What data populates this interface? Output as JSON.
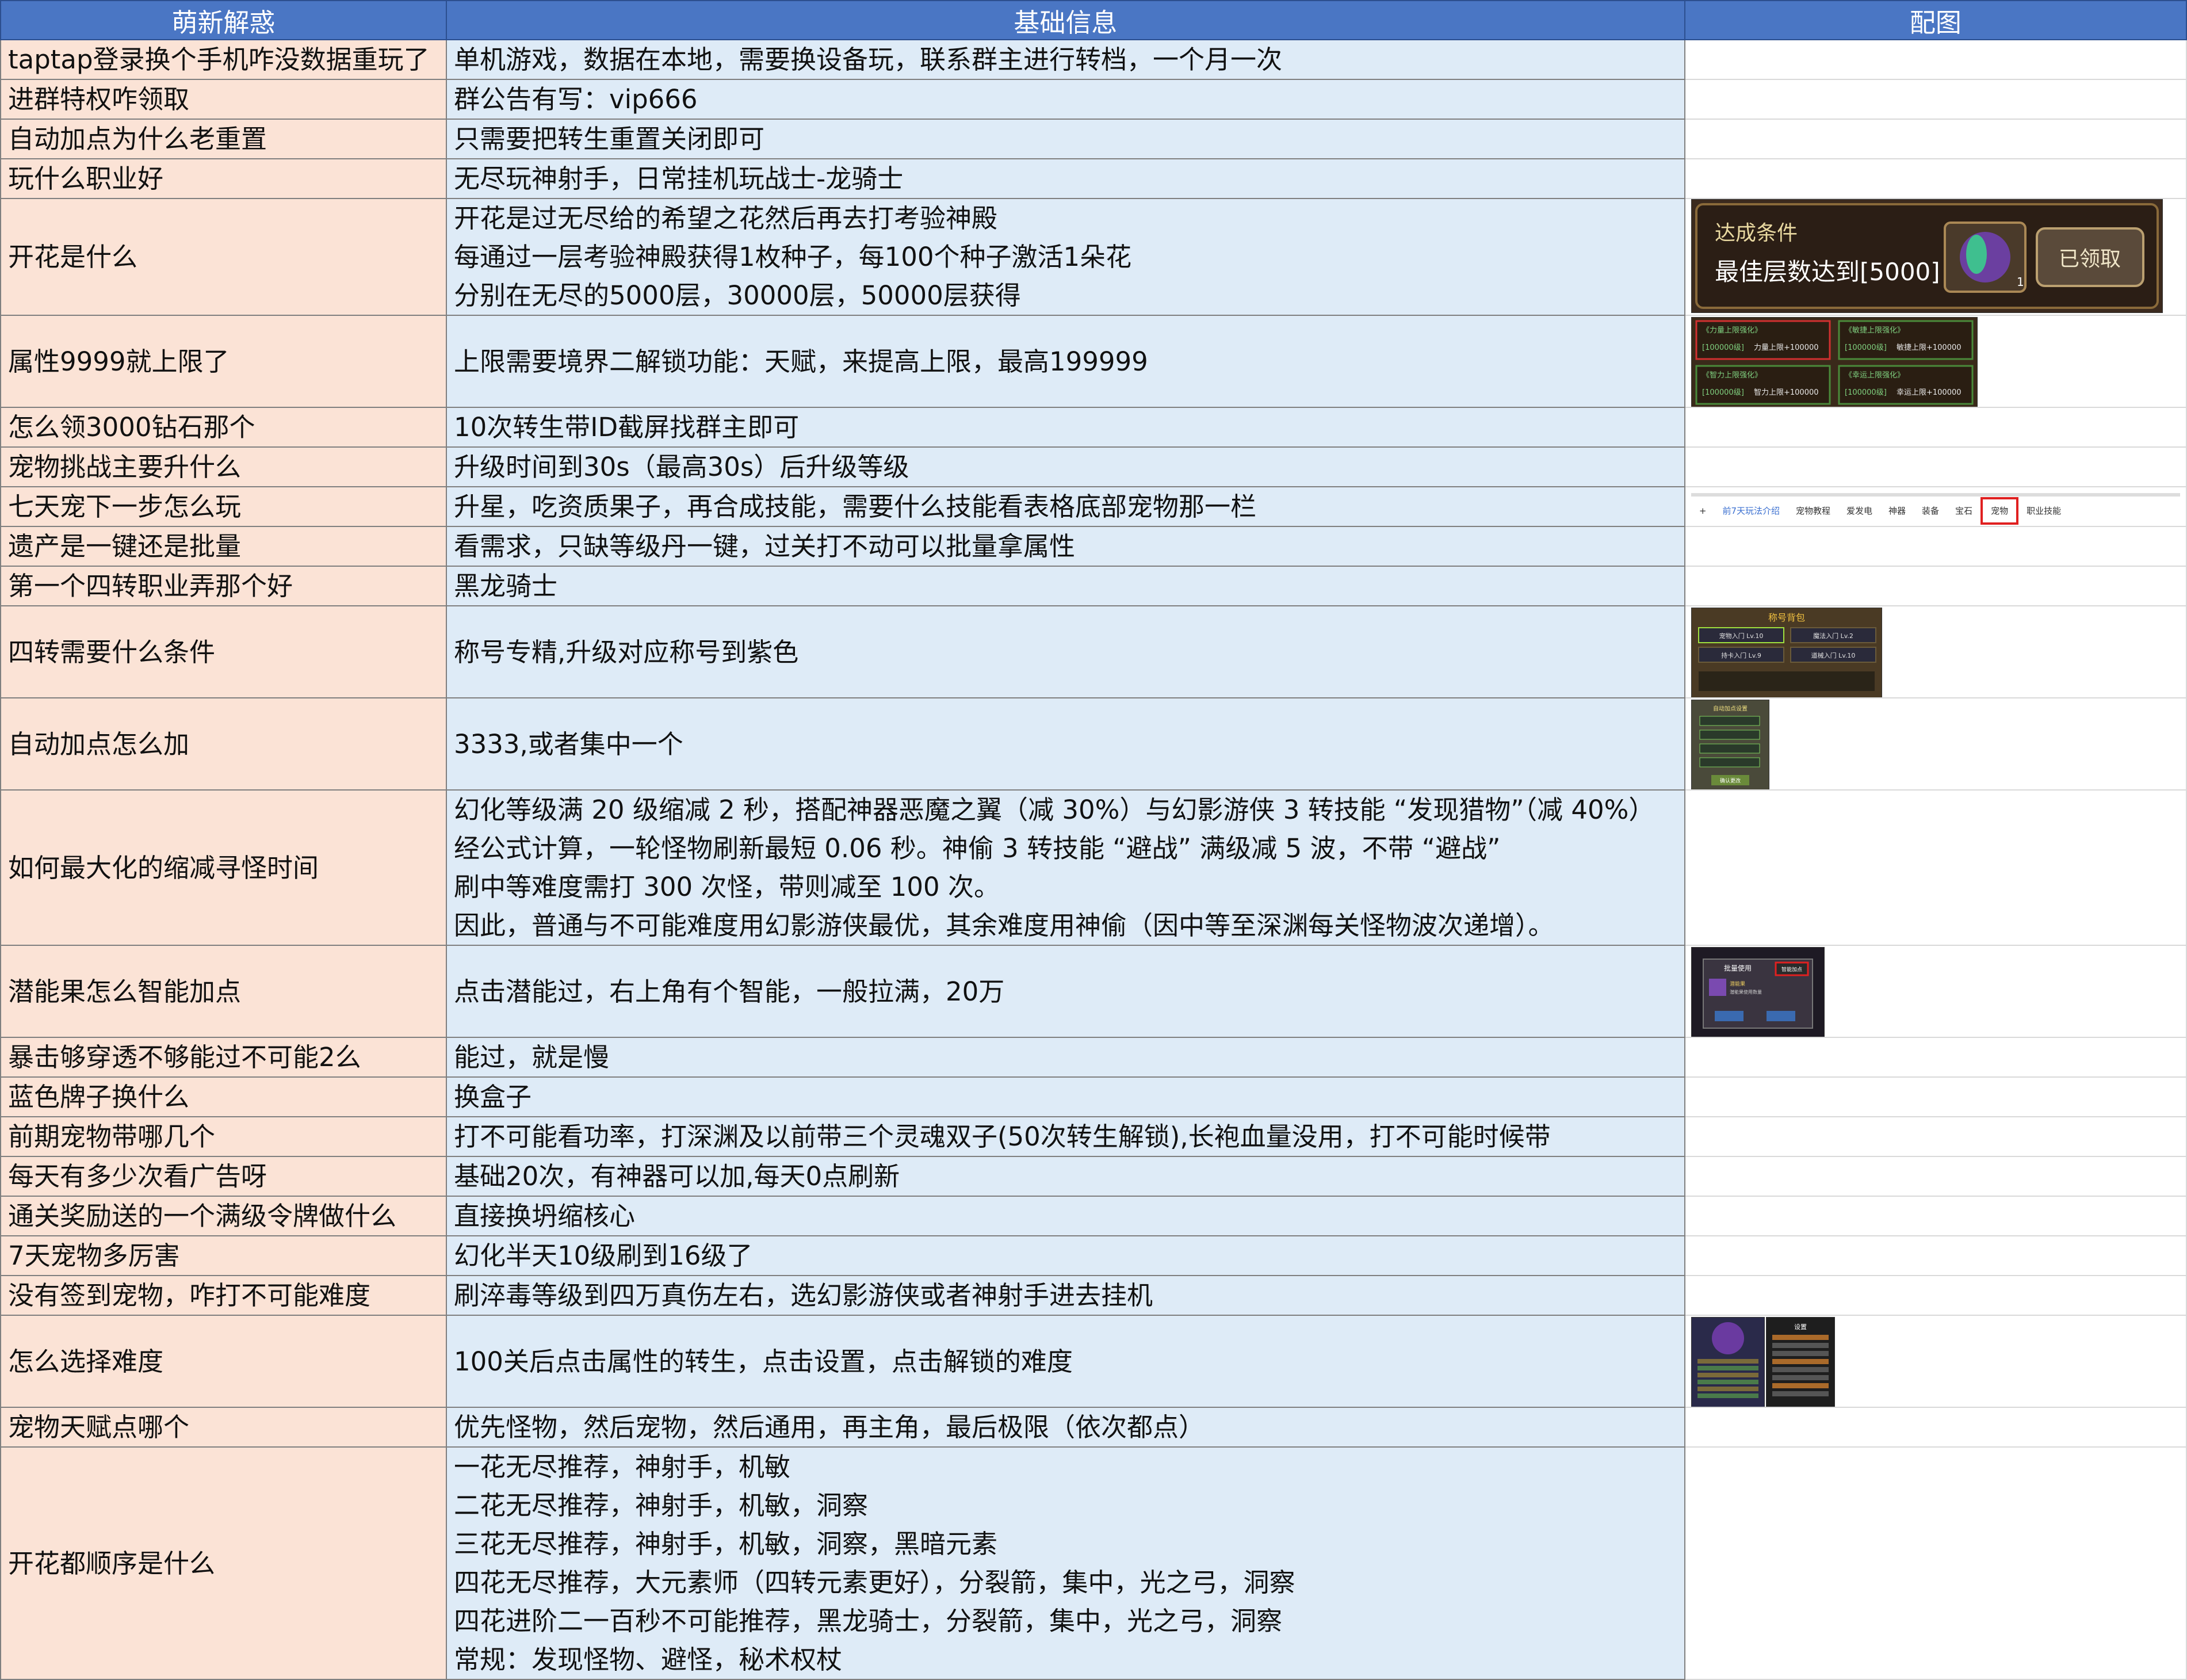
{
  "headers": [
    "萌新解惑",
    "基础信息",
    "配图"
  ],
  "rows": [
    {
      "q": "taptap登录换个手机咋没数据重玩了",
      "a": [
        "单机游戏，数据在本地，需要换设备玩，联系群主进行转档，一个月一次"
      ]
    },
    {
      "q": "进群特权咋领取",
      "a": [
        "群公告有写：vip666"
      ]
    },
    {
      "q": "自动加点为什么老重置",
      "a": [
        "只需要把转生重置关闭即可"
      ]
    },
    {
      "q": "玩什么职业好",
      "a": [
        "无尽玩神射手，日常挂机玩战士-龙骑士"
      ]
    },
    {
      "q": "开花是什么",
      "a": [
        "开花是过无尽给的希望之花然后再去打考验神殿",
        "每通过一层考验神殿获得1枚种子，每100个种子激活1朵花",
        "分别在无尽的5000层，30000层，50000层获得"
      ]
    },
    {
      "q": "属性9999就上限了",
      "a": [
        "上限需要境界二解锁功能：天赋，来提高上限，最高199999"
      ]
    },
    {
      "q": "怎么领3000钻石那个",
      "a": [
        "10次转生带ID截屏找群主即可"
      ]
    },
    {
      "q": "宠物挑战主要升什么",
      "a": [
        "升级时间到30s（最高30s）后升级等级"
      ]
    },
    {
      "q": "七天宠下一步怎么玩",
      "a": [
        "升星，吃资质果子，再合成技能，需要什么技能看表格底部宠物那一栏"
      ]
    },
    {
      "q": "遗产是一键还是批量",
      "a": [
        "看需求，只缺等级丹一键，过关打不动可以批量拿属性"
      ]
    },
    {
      "q": "第一个四转职业弄那个好",
      "a": [
        "黑龙骑士"
      ]
    },
    {
      "q": "四转需要什么条件",
      "a": [
        "称号专精,升级对应称号到紫色"
      ]
    },
    {
      "q": "自动加点怎么加",
      "a": [
        "3333,或者集中一个"
      ]
    },
    {
      "q": "如何最大化的缩减寻怪时间",
      "a": [
        "幻化等级满 20 级缩减 2 秒，搭配神器恶魔之翼（减 30%）与幻影游侠 3 转技能 “发现猎物”（减 40%）",
        "经公式计算，一轮怪物刷新最短 0.06 秒。神偷 3 转技能 “避战” 满级减 5 波，不带 “避战”",
        "刷中等难度需打 300 次怪，带则减至 100 次。",
        "因此，普通与不可能难度用幻影游侠最优，其余难度用神偷（因中等至深渊每关怪物波次递增）。"
      ]
    },
    {
      "q": "潜能果怎么智能加点",
      "a": [
        "点击潜能过，右上角有个智能，一般拉满，20万"
      ]
    },
    {
      "q": "暴击够穿透不够能过不可能2么",
      "a": [
        "能过，就是慢"
      ]
    },
    {
      "q": "蓝色牌子换什么",
      "a": [
        "换盒子"
      ]
    },
    {
      "q": "前期宠物带哪几个",
      "a": [
        "打不可能看功率，打深渊及以前带三个灵魂双子(50次转生解锁),长袍血量没用，打不可能时候带"
      ]
    },
    {
      "q": "每天有多少次看广告呀",
      "a": [
        "基础20次，有神器可以加,每天0点刷新"
      ]
    },
    {
      "q": "通关奖励送的一个满级令牌做什么",
      "a": [
        "直接换坍缩核心"
      ]
    },
    {
      "q": "7天宠物多厉害",
      "a": [
        "幻化半天10级刷到16级了"
      ]
    },
    {
      "q": "没有签到宠物，咋打不可能难度",
      "a": [
        "刷淬毒等级到四万真伤左右，选幻影游侠或者神射手进去挂机"
      ]
    },
    {
      "q": "怎么选择难度",
      "a": [
        "100关后点击属性的转生，点击设置，点击解锁的难度"
      ]
    },
    {
      "q": "宠物天赋点哪个",
      "a": [
        "优先怪物，然后宠物，然后通用，再主角，最后极限（依次都点）"
      ]
    },
    {
      "q": "开花都顺序是什么",
      "a": [
        "一花无尽推荐，神射手，机敏",
        "二花无尽推荐，神射手，机敏，洞察",
        "三花无尽推荐，神射手，机敏，洞察，黑暗元素",
        "四花无尽推荐，大元素师（四转元素更好），分裂箭，集中，光之弓，洞察",
        "四花进阶二一百秒不可能推荐，黑龙骑士，分裂箭，集中，光之弓，洞察",
        "常规：发现怪物、避怪，秘术权杖"
      ]
    }
  ],
  "images": {
    "bloom": {
      "title": "达成条件",
      "text": "最佳层数达到[5000]",
      "button": "已领取",
      "count": "1"
    },
    "attr": {
      "cells": [
        {
          "title": "《力量上限强化》",
          "tag": "[100000级]",
          "desc": "力量上限+100000"
        },
        {
          "title": "《敏捷上限强化》",
          "tag": "[100000级]",
          "desc": "敏捷上限+100000"
        },
        {
          "title": "《智力上限强化》",
          "tag": "[100000级]",
          "desc": "智力上限+100000"
        },
        {
          "title": "《幸运上限强化》",
          "tag": "[100000级]",
          "desc": "幸运上限+100000"
        }
      ]
    },
    "tabs": {
      "plus": "+",
      "items": [
        "前7天玩法介绍",
        "宠物教程",
        "爱发电",
        "神器",
        "装备",
        "宝石",
        "宠物",
        "职业技能"
      ],
      "highlight": 6
    },
    "title_bag": {
      "title": "称号背包",
      "items": [
        "宠物入门 Lv.10",
        "魔法入门 Lv.2",
        "持卡入门 Lv.9",
        "道械入门 Lv.10"
      ]
    },
    "auto_point": {
      "title": "自动加点设置",
      "footer": "确认更改"
    },
    "potential": {
      "title": "批量使用",
      "button": "智能加点",
      "item": "潜能果",
      "desc": "潜能果使用数量"
    },
    "difficulty": {
      "title": "设置"
    }
  }
}
